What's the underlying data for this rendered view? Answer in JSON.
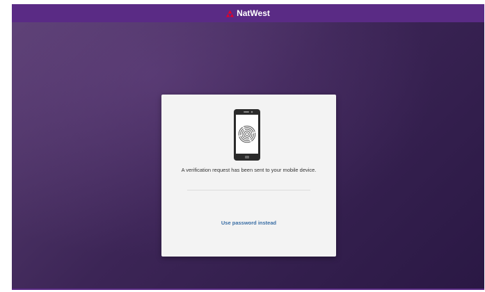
{
  "header": {
    "brand_name": "NatWest",
    "brand_icon": "natwest-logo-icon",
    "brand_color": "#e4002b",
    "bar_color": "#5a2b85"
  },
  "card": {
    "illustration": "phone-fingerprint-icon",
    "message": "A verification request has been sent to your mobile device.",
    "alt_link": "Use password instead",
    "link_color": "#3a6ea5"
  }
}
